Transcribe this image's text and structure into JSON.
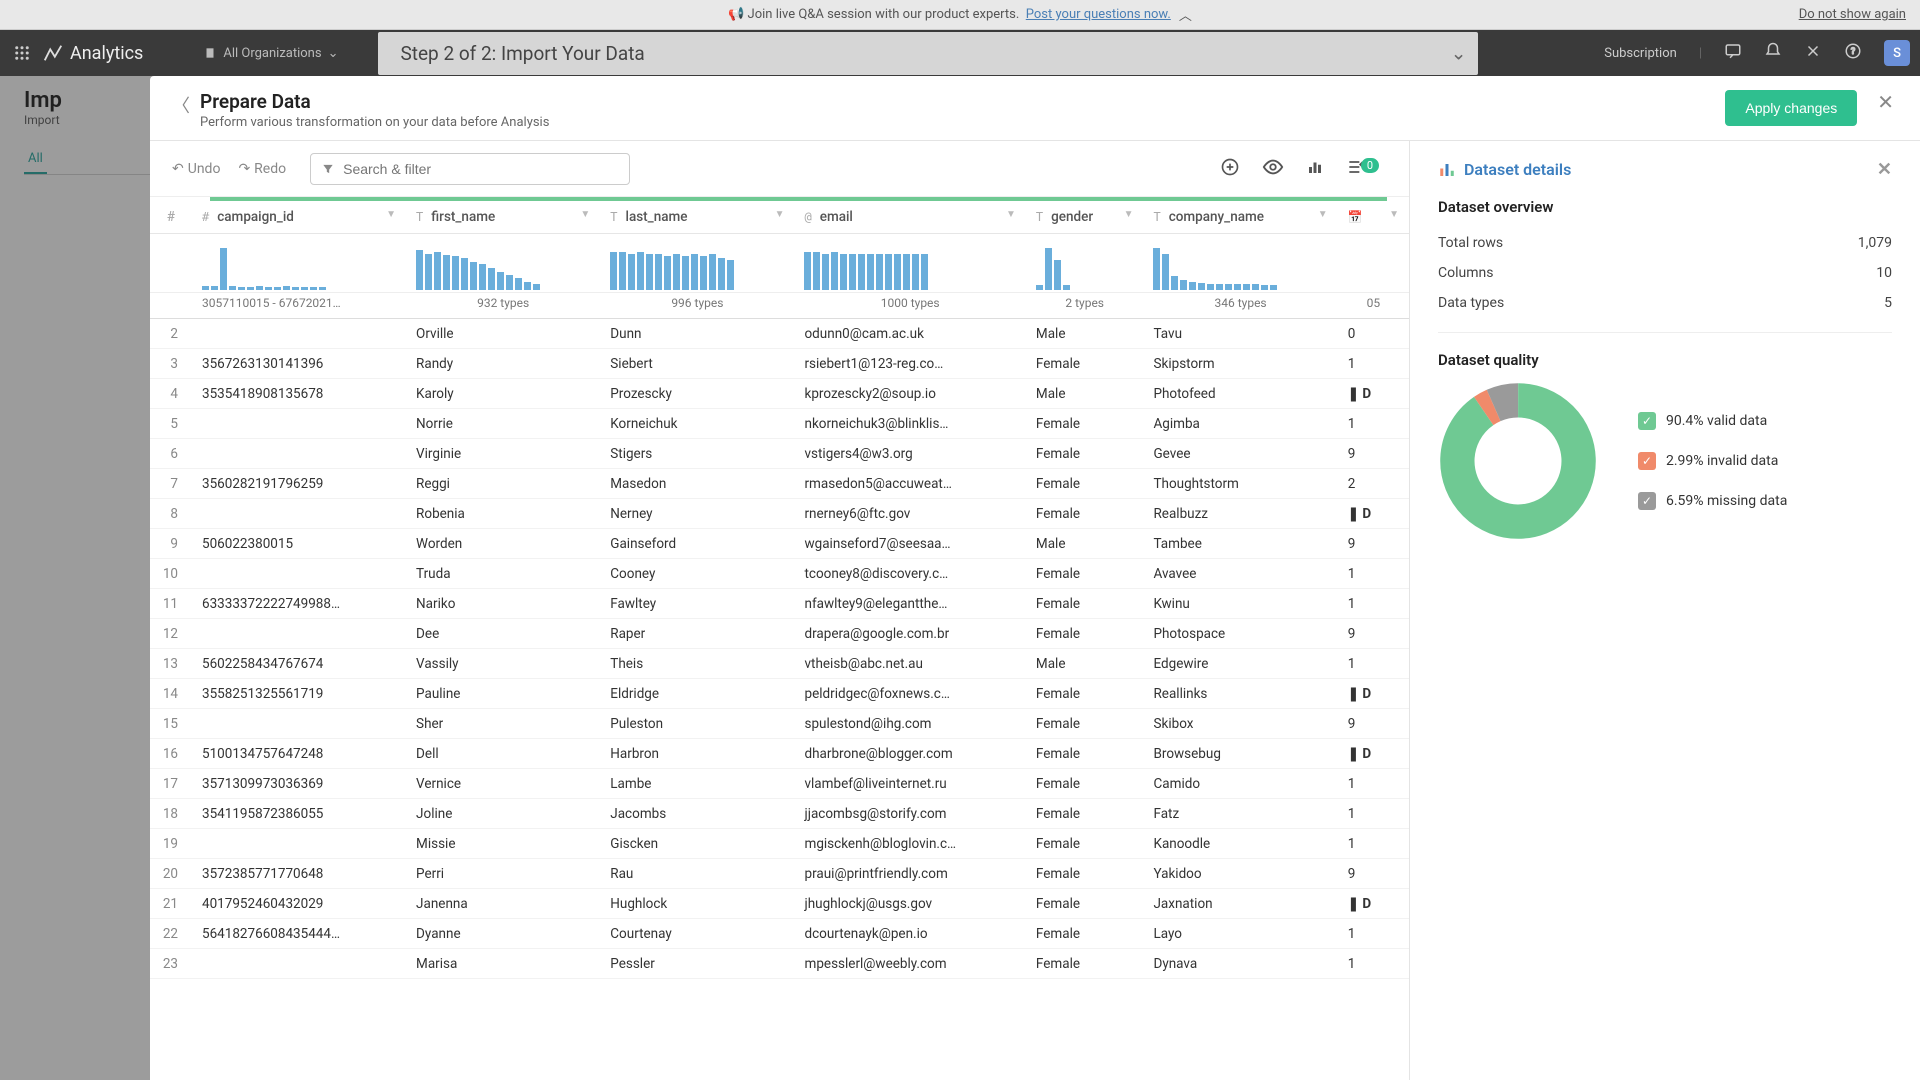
{
  "banner": {
    "icon": "📢",
    "text": "Join live Q&A session with our product experts.",
    "link": "Post your questions now.",
    "dismiss": "Do not show again"
  },
  "topbar": {
    "brand": "Analytics",
    "org": "All Organizations",
    "step": "Step 2 of 2: Import Your Data",
    "subscription": "Subscription",
    "avatar": "S"
  },
  "bg": {
    "heading": "Imp",
    "sub": "Import",
    "tab": "All"
  },
  "modal": {
    "title": "Prepare Data",
    "subtitle": "Perform various transformation on your data before Analysis",
    "apply": "Apply changes",
    "undo": "Undo",
    "redo": "Redo",
    "search_placeholder": "Search & filter",
    "badge": "0"
  },
  "columns": [
    {
      "type": "#",
      "name": "campaign_id",
      "range": "3057110015 - 67672021…",
      "types": ""
    },
    {
      "type": "T",
      "name": "first_name",
      "range": "",
      "types": "932 types"
    },
    {
      "type": "T",
      "name": "last_name",
      "range": "",
      "types": "996 types"
    },
    {
      "type": "@",
      "name": "email",
      "range": "",
      "types": "1000 types"
    },
    {
      "type": "T",
      "name": "gender",
      "range": "",
      "types": "2 types"
    },
    {
      "type": "T",
      "name": "company_name",
      "range": "",
      "types": "346 types"
    },
    {
      "type": "📅",
      "name": "",
      "range": "",
      "types": "05"
    }
  ],
  "hist_profiles": [
    [
      4,
      4,
      42,
      4,
      3,
      3,
      4,
      3,
      3,
      4,
      3,
      3,
      3,
      3
    ],
    [
      40,
      36,
      38,
      35,
      34,
      32,
      28,
      26,
      22,
      18,
      15,
      12,
      8,
      6
    ],
    [
      38,
      38,
      36,
      38,
      36,
      36,
      34,
      36,
      34,
      36,
      34,
      36,
      32,
      30
    ],
    [
      38,
      38,
      36,
      38,
      36,
      36,
      36,
      36,
      36,
      36,
      36,
      36,
      36,
      36
    ],
    [
      5,
      42,
      30,
      5
    ],
    [
      42,
      36,
      14,
      10,
      8,
      7,
      6,
      6,
      6,
      6,
      6,
      6,
      5,
      5
    ]
  ],
  "rows": [
    {
      "n": 2,
      "campaign_id": "",
      "first": "Orville",
      "last": "Dunn",
      "email": "odunn0@cam.ac.uk",
      "gender": "Male",
      "company": "Tavu",
      "flag": false,
      "extra": "0"
    },
    {
      "n": 3,
      "campaign_id": "3567263130141396",
      "first": "Randy",
      "last": "Siebert",
      "email": "rsiebert1@123-reg.co…",
      "gender": "Female",
      "company": "Skipstorm",
      "flag": false,
      "extra": "1"
    },
    {
      "n": 4,
      "campaign_id": "3535418908135678",
      "first": "Karoly",
      "last": "Prozescky",
      "email": "kprozescky2@soup.io",
      "gender": "Male",
      "company": "Photofeed",
      "flag": true,
      "extra": "D"
    },
    {
      "n": 5,
      "campaign_id": "",
      "first": "Norrie",
      "last": "Korneichuk",
      "email": "nkorneichuk3@blinklis…",
      "gender": "Female",
      "company": "Agimba",
      "flag": false,
      "extra": "1"
    },
    {
      "n": 6,
      "campaign_id": "",
      "first": "Virginie",
      "last": "Stigers",
      "email": "vstigers4@w3.org",
      "gender": "Female",
      "company": "Gevee",
      "flag": false,
      "extra": "9"
    },
    {
      "n": 7,
      "campaign_id": "3560282191796259",
      "first": "Reggi",
      "last": "Masedon",
      "email": "rmasedon5@accuweat…",
      "gender": "Female",
      "company": "Thoughtstorm",
      "flag": false,
      "extra": "2"
    },
    {
      "n": 8,
      "campaign_id": "",
      "first": "Robenia",
      "last": "Nerney",
      "email": "rnerney6@ftc.gov",
      "gender": "Female",
      "company": "Realbuzz",
      "flag": true,
      "extra": "D"
    },
    {
      "n": 9,
      "campaign_id": "506022380015",
      "first": "Worden",
      "last": "Gainseford",
      "email": "wgainseford7@seesaa…",
      "gender": "Male",
      "company": "Tambee",
      "flag": false,
      "extra": "9"
    },
    {
      "n": 10,
      "campaign_id": "",
      "first": "Truda",
      "last": "Cooney",
      "email": "tcooney8@discovery.c…",
      "gender": "Female",
      "company": "Avavee",
      "flag": false,
      "extra": "1"
    },
    {
      "n": 11,
      "campaign_id": "63333372222749988…",
      "first": "Nariko",
      "last": "Fawltey",
      "email": "nfawltey9@elegantthe…",
      "gender": "Female",
      "company": "Kwinu",
      "flag": false,
      "extra": "1"
    },
    {
      "n": 12,
      "campaign_id": "",
      "first": "Dee",
      "last": "Raper",
      "email": "drapera@google.com.br",
      "gender": "Female",
      "company": "Photospace",
      "flag": false,
      "extra": "9"
    },
    {
      "n": 13,
      "campaign_id": "5602258434767674",
      "first": "Vassily",
      "last": "Theis",
      "email": "vtheisb@abc.net.au",
      "gender": "Male",
      "company": "Edgewire",
      "flag": false,
      "extra": "1"
    },
    {
      "n": 14,
      "campaign_id": "3558251325561719",
      "first": "Pauline",
      "last": "Eldridge",
      "email": "peldridgec@foxnews.c…",
      "gender": "Female",
      "company": "Reallinks",
      "flag": true,
      "extra": "D"
    },
    {
      "n": 15,
      "campaign_id": "",
      "first": "Sher",
      "last": "Puleston",
      "email": "spulestond@ihg.com",
      "gender": "Female",
      "company": "Skibox",
      "flag": false,
      "extra": "9"
    },
    {
      "n": 16,
      "campaign_id": "5100134757647248",
      "first": "Dell",
      "last": "Harbron",
      "email": "dharbrone@blogger.com",
      "gender": "Female",
      "company": "Browsebug",
      "flag": true,
      "extra": "D"
    },
    {
      "n": 17,
      "campaign_id": "3571309973036369",
      "first": "Vernice",
      "last": "Lambe",
      "email": "vlambef@liveinternet.ru",
      "gender": "Female",
      "company": "Camido",
      "flag": false,
      "extra": "1"
    },
    {
      "n": 18,
      "campaign_id": "3541195872386055",
      "first": "Joline",
      "last": "Jacombs",
      "email": "jjacombsg@storify.com",
      "gender": "Female",
      "company": "Fatz",
      "flag": false,
      "extra": "1"
    },
    {
      "n": 19,
      "campaign_id": "",
      "first": "Missie",
      "last": "Giscken",
      "email": "mgisckenh@bloglovin.c…",
      "gender": "Female",
      "company": "Kanoodle",
      "flag": false,
      "extra": "1"
    },
    {
      "n": 20,
      "campaign_id": "3572385771770648",
      "first": "Perri",
      "last": "Rau",
      "email": "praui@printfriendly.com",
      "gender": "Female",
      "company": "Yakidoo",
      "flag": false,
      "extra": "9"
    },
    {
      "n": 21,
      "campaign_id": "4017952460432029",
      "first": "Janenna",
      "last": "Hughlock",
      "email": "jhughlockj@usgs.gov",
      "gender": "Female",
      "company": "Jaxnation",
      "flag": true,
      "extra": "D"
    },
    {
      "n": 22,
      "campaign_id": "56418276608435444…",
      "first": "Dyanne",
      "last": "Courtenay",
      "email": "dcourtenayk@pen.io",
      "gender": "Female",
      "company": "Layo",
      "flag": false,
      "extra": "1"
    },
    {
      "n": 23,
      "campaign_id": "",
      "first": "Marisa",
      "last": "Pessler",
      "email": "mpesslerl@weebly.com",
      "gender": "Female",
      "company": "Dynava",
      "flag": false,
      "extra": "1"
    }
  ],
  "details": {
    "title": "Dataset details",
    "overview_title": "Dataset overview",
    "total_rows_label": "Total rows",
    "total_rows": "1,079",
    "columns_label": "Columns",
    "columns": "10",
    "datatypes_label": "Data types",
    "datatypes": "5",
    "quality_title": "Dataset quality",
    "valid": "90.4% valid data",
    "invalid": "2.99% invalid data",
    "missing": "6.59% missing data"
  },
  "chart_data": {
    "type": "pie",
    "title": "Dataset quality",
    "series": [
      {
        "name": "valid data",
        "value": 90.4,
        "color": "#6fc993"
      },
      {
        "name": "invalid data",
        "value": 2.99,
        "color": "#f08a6a"
      },
      {
        "name": "missing data",
        "value": 6.59,
        "color": "#9a9a9a"
      }
    ]
  }
}
